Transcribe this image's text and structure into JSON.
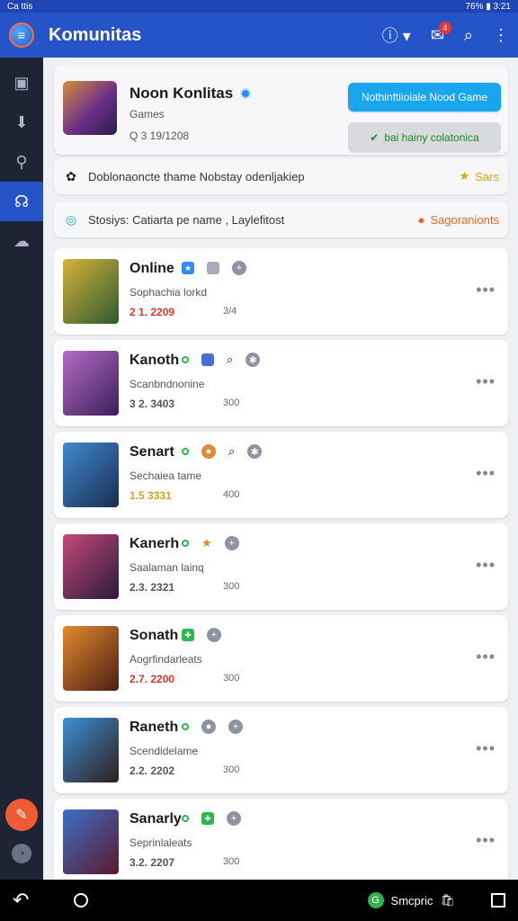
{
  "status_bar": {
    "left": "Ca ttis",
    "right": "76% ▮ 3:21"
  },
  "appbar": {
    "title": "Komunitas",
    "notification_count": "4"
  },
  "header": {
    "title": "Noon Konlitas",
    "subtitle": "Games",
    "meta": "Q 3 19/1208",
    "primary_button": "Nothinftiioiale Nood Game",
    "secondary_button": "bai  hainy colatonica"
  },
  "notices": [
    {
      "label": "Doblonaoncte thame Nobstay odenljakiep",
      "right_label": "Sars",
      "accent": "#d6a800"
    },
    {
      "label": "Stosiys: Catiarta pe name , Laylefitost",
      "right_label": "Sagoranionts",
      "accent": "#e06a2a"
    }
  ],
  "communities": [
    {
      "name": "Online",
      "sub": "Sophachia lorkd",
      "date": "2 1. 2209",
      "date_color": "#d03b2b",
      "count": "3/4",
      "colors": [
        "#d7b33a",
        "#2b5a2f"
      ]
    },
    {
      "name": "Kanoth",
      "sub": "Scanbndnonine",
      "date": "3 2. 3403",
      "date_color": "#555555",
      "count": "300",
      "colors": [
        "#b46cc4",
        "#3a1f5c"
      ]
    },
    {
      "name": "Senart",
      "sub": "Sechaiea tame",
      "date": "1.5 3331",
      "date_color": "#d4a21b",
      "count": "400",
      "colors": [
        "#3f8ad1",
        "#1b2d4f"
      ]
    },
    {
      "name": "Kanerh",
      "sub": "Saalaman lainq",
      "date": "2.3. 2321",
      "date_color": "#555555",
      "count": "300",
      "colors": [
        "#c44a7a",
        "#2a1a3a"
      ]
    },
    {
      "name": "Sonath",
      "sub": "Aogrfindarleats",
      "date": "2.7. 2200",
      "date_color": "#d03b2b",
      "count": "300",
      "colors": [
        "#e38a2c",
        "#4a1e14"
      ]
    },
    {
      "name": "Raneth",
      "sub": "Scendidelame",
      "date": "2.2. 2202",
      "date_color": "#555555",
      "count": "300",
      "colors": [
        "#3c8fd6",
        "#2f1f1a"
      ]
    },
    {
      "name": "Sanarly",
      "sub": "Seprinlaleats",
      "date": "3.2. 2207",
      "date_color": "#555555",
      "count": "300",
      "colors": [
        "#3d6ec9",
        "#5a1a2a"
      ]
    }
  ],
  "bottom_nav": {
    "pill_label": "Smcpric"
  }
}
